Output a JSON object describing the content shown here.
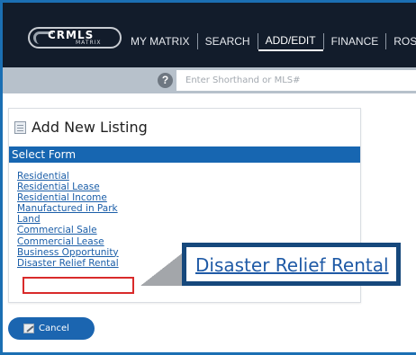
{
  "header": {
    "logo_text": "CRMLS",
    "logo_sub": "MATRIX",
    "nav": [
      {
        "label": "MY MATRIX"
      },
      {
        "label": "SEARCH"
      },
      {
        "label": "ADD/EDIT"
      },
      {
        "label": "FINANCE"
      },
      {
        "label": "ROSTE"
      }
    ],
    "active_nav": "ADD/EDIT"
  },
  "search": {
    "placeholder": "Enter Shorthand or MLS#",
    "help_icon": "?"
  },
  "panel": {
    "title": "Add New Listing",
    "section": "Select Form",
    "links": [
      "Residential",
      "Residential Lease",
      "Residential Income",
      "Manufactured in Park",
      "Land",
      "Commercial Sale",
      "Commercial Lease",
      "Business Opportunity",
      "Disaster Relief Rental"
    ],
    "highlighted": "Disaster Relief Rental"
  },
  "callout": {
    "text": "Disaster Relief Rental"
  },
  "cancel": {
    "label": "Cancel"
  },
  "colors": {
    "header_bg": "#121c2b",
    "band_bg": "#b7c1cb",
    "accent_blue": "#1766b1",
    "link_blue": "#1b5ea8",
    "highlight_red": "#d92a2a",
    "callout_border": "#16487c"
  }
}
